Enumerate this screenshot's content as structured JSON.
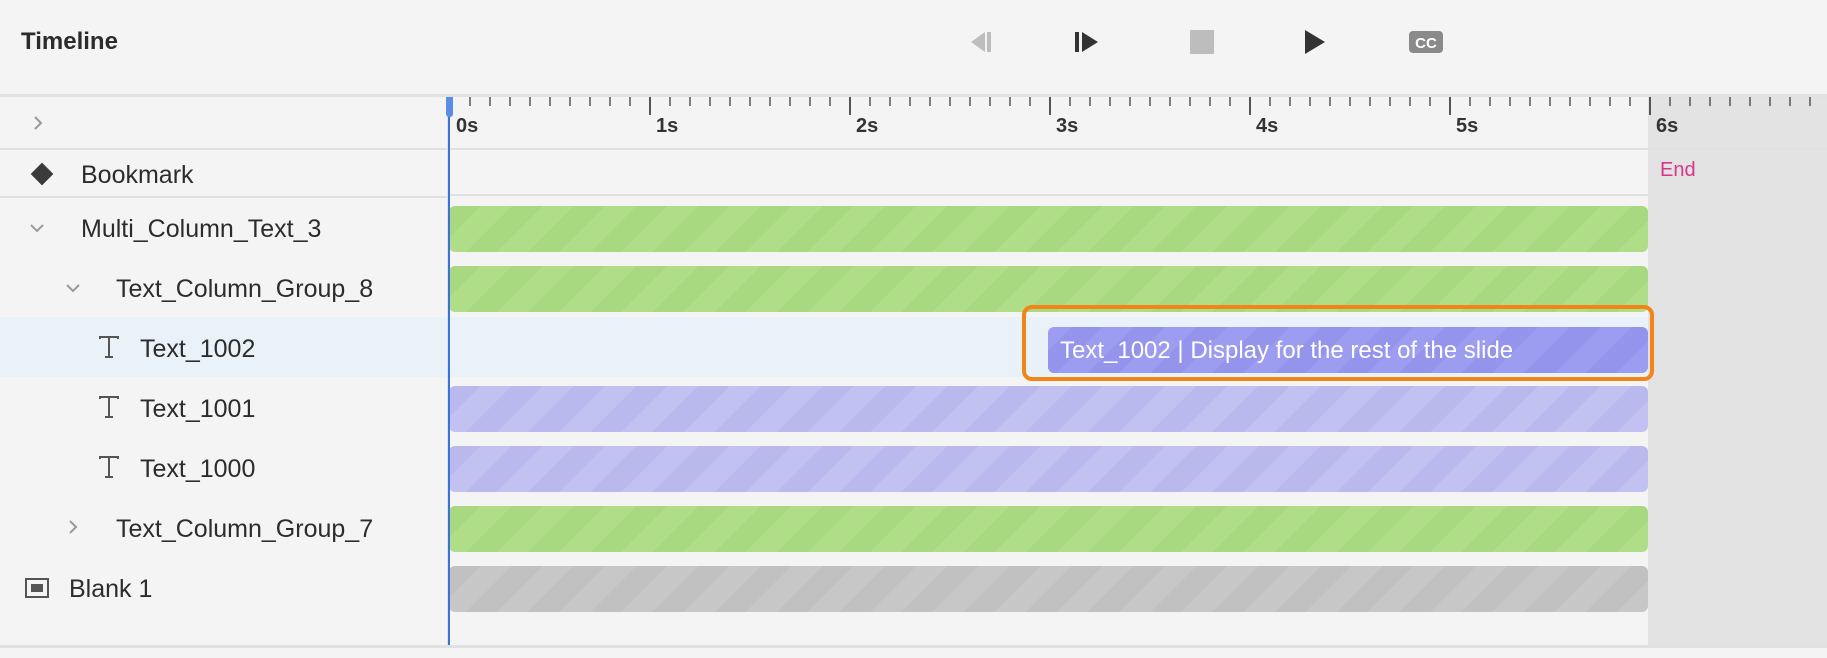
{
  "header": {
    "title": "Timeline",
    "controls": [
      {
        "name": "previous-frame-button",
        "icon": "step-back-icon"
      },
      {
        "name": "next-frame-button",
        "icon": "step-forward-icon"
      },
      {
        "name": "stop-button",
        "icon": "stop-icon"
      },
      {
        "name": "play-button",
        "icon": "play-icon"
      },
      {
        "name": "closed-captions-button",
        "icon": "cc-icon"
      }
    ]
  },
  "ruler": {
    "ticks": [
      "0s",
      "1s",
      "2s",
      "3s",
      "4s",
      "5s",
      "6s"
    ],
    "end_label": "End"
  },
  "layers": {
    "bookmark": "Bookmark",
    "multi_column": "Multi_Column_Text_3",
    "group8": "Text_Column_Group_8",
    "text1002": "Text_1002",
    "text1001": "Text_1001",
    "text1000": "Text_1000",
    "group7": "Text_Column_Group_7",
    "blank": "Blank 1"
  },
  "selected_bar": {
    "text": "Text_1002 | Display for the rest of the slide"
  },
  "colors": {
    "accent_highlight": "#f28418",
    "end_marker": "#d9368a",
    "playhead": "#3a73d6",
    "group_bar": "#b0de88",
    "text_bar": "#c2c2f2",
    "selected_text_bar": "#9c9cf0",
    "slide_bar": "#c7c7c7"
  }
}
